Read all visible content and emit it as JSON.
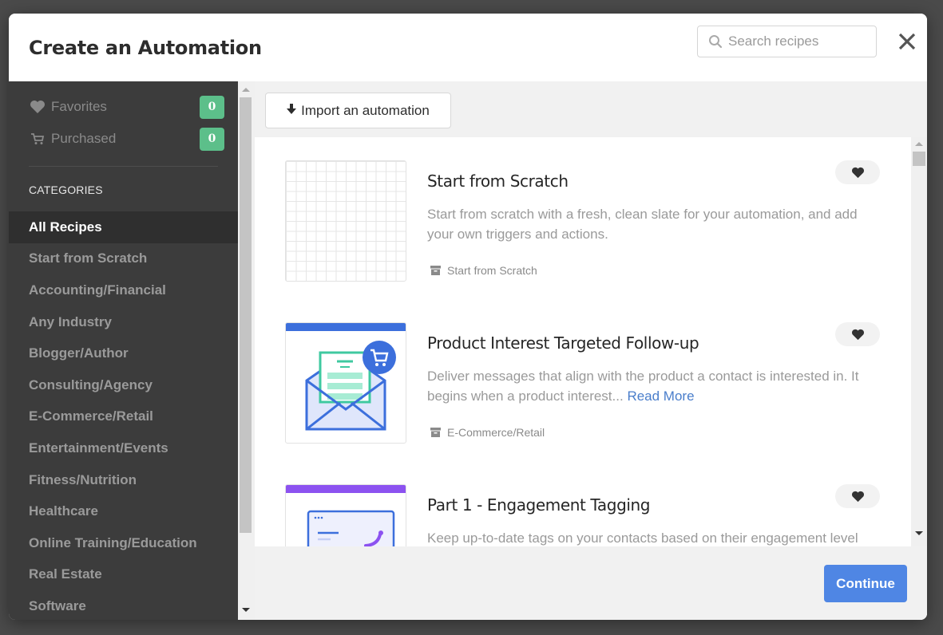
{
  "modal": {
    "title": "Create an Automation",
    "search": {
      "placeholder": "Search recipes",
      "value": ""
    },
    "close_label": "×"
  },
  "sidebar": {
    "favorites": {
      "label": "Favorites",
      "count": "0",
      "icon": "heart-icon"
    },
    "purchased": {
      "label": "Purchased",
      "count": "0",
      "icon": "cart-icon"
    },
    "categories_label": "CATEGORIES",
    "categories": [
      {
        "label": "All Recipes",
        "active": true
      },
      {
        "label": "Start from Scratch",
        "active": false
      },
      {
        "label": "Accounting/Financial",
        "active": false
      },
      {
        "label": "Any Industry",
        "active": false
      },
      {
        "label": "Blogger/Author",
        "active": false
      },
      {
        "label": "Consulting/Agency",
        "active": false
      },
      {
        "label": "E-Commerce/Retail",
        "active": false
      },
      {
        "label": "Entertainment/Events",
        "active": false
      },
      {
        "label": "Fitness/Nutrition",
        "active": false
      },
      {
        "label": "Healthcare",
        "active": false
      },
      {
        "label": "Online Training/Education",
        "active": false
      },
      {
        "label": "Real Estate",
        "active": false
      },
      {
        "label": "Software",
        "active": false
      }
    ]
  },
  "main": {
    "import_label": "Import an automation",
    "recipes": [
      {
        "title": "Start from Scratch",
        "description": "Start from scratch with a fresh, clean slate for your automation, and add your own triggers and actions.",
        "read_more": "",
        "category": "Start from Scratch",
        "thumbnail": "grid"
      },
      {
        "title": "Product Interest Targeted Follow-up",
        "description": "Deliver messages that align with the product a contact is interested in. It begins when a product interest...",
        "read_more": "Read More",
        "category": "E-Commerce/Retail",
        "thumbnail": "envelope-cart",
        "band_color": "#3c6fdc"
      },
      {
        "title": "Part 1 - Engagement Tagging",
        "description": "Keep up-to-date tags on your contacts based on their engagement level",
        "read_more": "",
        "category": "",
        "thumbnail": "browser-chart",
        "band_color": "#8c52f0"
      }
    ]
  },
  "footer": {
    "continue_label": "Continue"
  },
  "colors": {
    "accent": "#4f86e4",
    "badge": "#5cbf8a",
    "sidebar_bg": "#3c3c3c",
    "link": "#4a7ecb"
  }
}
